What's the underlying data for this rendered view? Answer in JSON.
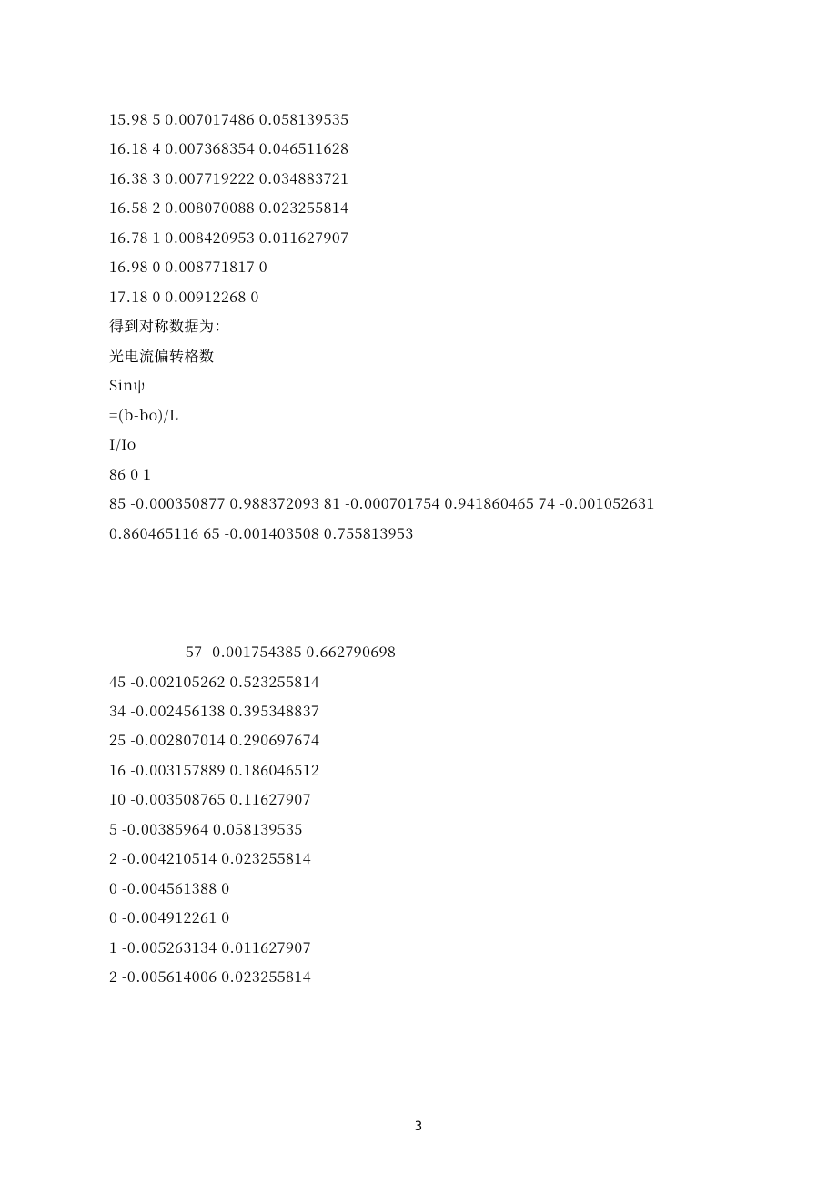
{
  "block1": [
    "15.98 5 0.007017486 0.058139535",
    "16.18 4 0.007368354 0.046511628",
    "16.38 3 0.007719222 0.034883721",
    "16.58 2 0.008070088 0.023255814",
    "16.78 1 0.008420953 0.011627907",
    "16.98 0 0.008771817 0",
    "17.18 0 0.00912268 0",
    "得到对称数据为：",
    "光电流偏转格数",
    "Sinψ",
    "=(b-bo)/L",
    "I/Io",
    "86 0 1",
    "85 -0.000350877 0.988372093 81 -0.000701754 0.941860465 74 -0.001052631",
    "0.860465116 65 -0.001403508 0.755813953"
  ],
  "indent_line": "57 -0.001754385 0.662790698",
  "block2": [
    "45 -0.002105262 0.523255814",
    "34 -0.002456138 0.395348837",
    "25 -0.002807014 0.290697674",
    "16 -0.003157889 0.186046512",
    "10 -0.003508765 0.11627907",
    "5 -0.00385964 0.058139535",
    "2 -0.004210514 0.023255814",
    "0 -0.004561388 0",
    "0 -0.004912261 0",
    "1 -0.005263134 0.011627907",
    "2 -0.005614006 0.023255814"
  ],
  "page_number": "3"
}
